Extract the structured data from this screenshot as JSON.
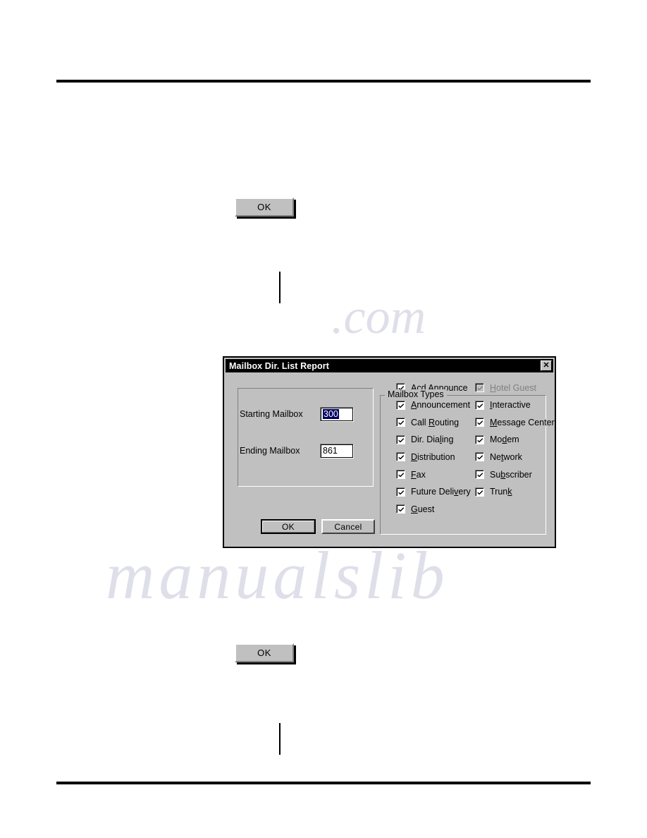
{
  "page": {
    "rules": [
      "top-rule",
      "bottom-rule"
    ],
    "change_bars": [
      "upper-change-bar",
      "lower-change-bar"
    ]
  },
  "standalone_buttons": [
    {
      "label": "OK",
      "name": "ok-button-upper"
    },
    {
      "label": "OK",
      "name": "ok-button-lower"
    }
  ],
  "dialog": {
    "title": "Mailbox Dir. List Report",
    "close_glyph": "✕",
    "fields": [
      {
        "label": "Starting  Mailbox",
        "value": "300",
        "selected": true
      },
      {
        "label": "Ending  Mailbox",
        "value": "861",
        "selected": false
      }
    ],
    "buttons": {
      "ok": "OK",
      "cancel": "Cancel"
    },
    "types_group": {
      "legend": "Mailbox Types",
      "left_column": [
        {
          "pre": "A",
          "key": "c",
          "post": "d Announce",
          "checked": true,
          "enabled": true
        },
        {
          "pre": "",
          "key": "A",
          "post": "nnouncement",
          "checked": true,
          "enabled": true
        },
        {
          "pre": "Call ",
          "key": "R",
          "post": "outing",
          "checked": true,
          "enabled": true
        },
        {
          "pre": "Dir. Dia",
          "key": "l",
          "post": "ing",
          "checked": true,
          "enabled": true
        },
        {
          "pre": "",
          "key": "D",
          "post": "istribution",
          "checked": true,
          "enabled": true
        },
        {
          "pre": "",
          "key": "F",
          "post": "ax",
          "checked": true,
          "enabled": true
        },
        {
          "pre": "Future Deli",
          "key": "v",
          "post": "ery",
          "checked": true,
          "enabled": true
        },
        {
          "pre": "",
          "key": "G",
          "post": "uest",
          "checked": true,
          "enabled": true
        }
      ],
      "right_column": [
        {
          "pre": "",
          "key": "H",
          "post": "otel Guest",
          "checked": true,
          "enabled": false
        },
        {
          "pre": "",
          "key": "I",
          "post": "nteractive",
          "checked": true,
          "enabled": true
        },
        {
          "pre": "",
          "key": "M",
          "post": "essage Center",
          "checked": true,
          "enabled": true
        },
        {
          "pre": "Mo",
          "key": "d",
          "post": "em",
          "checked": true,
          "enabled": true
        },
        {
          "pre": "Ne",
          "key": "t",
          "post": "work",
          "checked": true,
          "enabled": true
        },
        {
          "pre": "Su",
          "key": "b",
          "post": "scriber",
          "checked": true,
          "enabled": true
        },
        {
          "pre": "Trun",
          "key": "k",
          "post": "",
          "checked": true,
          "enabled": true
        }
      ]
    }
  },
  "colors": {
    "dialog_face": "#c0c0c0",
    "titlebar": "#000000",
    "titlebar_text": "#ffffff",
    "selection": "#000060",
    "disabled_text": "#808080",
    "page_background": "#ffffff"
  }
}
